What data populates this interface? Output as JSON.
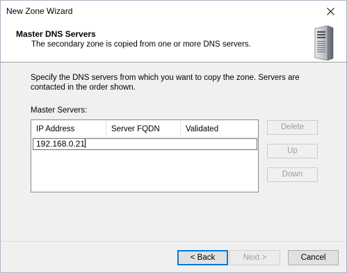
{
  "window": {
    "title": "New Zone Wizard"
  },
  "header": {
    "title": "Master DNS Servers",
    "subtitle": "The secondary zone is copied from one or more DNS servers."
  },
  "instructions": "Specify the DNS servers from which you want to copy the zone.  Servers are contacted in the order shown.",
  "master_servers": {
    "label": "Master Servers:",
    "columns": [
      "IP Address",
      "Server FQDN",
      "Validated"
    ],
    "edit_value": "192.168.0.21"
  },
  "side_buttons": {
    "delete": "Delete",
    "up": "Up",
    "down": "Down"
  },
  "footer_buttons": {
    "back": "< Back",
    "next": "Next >",
    "cancel": "Cancel"
  }
}
